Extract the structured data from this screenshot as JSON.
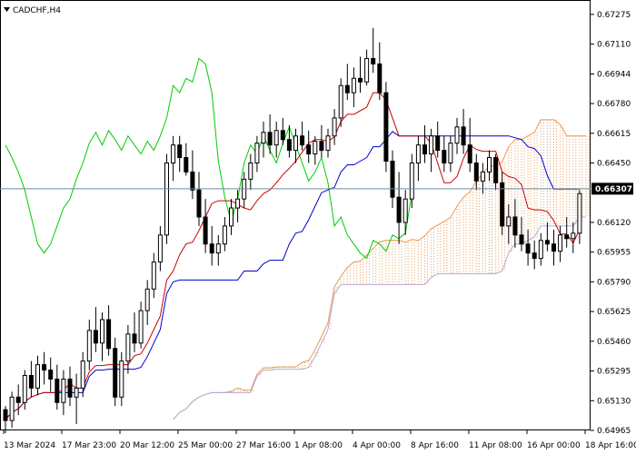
{
  "window": {
    "symbol_label": "CADCHF,H4"
  },
  "price_axis": {
    "labels": [
      "0.67275",
      "0.67110",
      "0.66944",
      "0.66780",
      "0.66615",
      "0.66450",
      "0.66120",
      "0.65955",
      "0.65790",
      "0.65625",
      "0.65460",
      "0.65295",
      "0.65130",
      "0.64965"
    ],
    "current_price": "0.66307"
  },
  "time_axis": {
    "labels": [
      "13 Mar 2024",
      "17 Mar 23:00",
      "20 Mar 12:00",
      "25 Mar 00:00",
      "27 Mar 16:00",
      "1 Apr 08:00",
      "4 Apr 00:00",
      "8 Apr 16:00",
      "11 Apr 08:00",
      "16 Apr 00:00",
      "18 Apr 16:00"
    ]
  },
  "colors": {
    "background": "#ffffff",
    "grid": "#c8c8c8",
    "candle": "#000000",
    "tenkan": "#cc0000",
    "kijun": "#0000cc",
    "chikou": "#00cc00",
    "cloud_bull": "#e69a50",
    "cloud_bear": "#b8a8d8",
    "price_line": "#6f8a9a",
    "price_tag_bg": "#000000"
  },
  "chart_data": {
    "type": "candlestick",
    "title": "CADCHF,H4",
    "xlabel": "",
    "ylabel": "",
    "ylim": [
      0.64965,
      0.67355
    ],
    "current_price": 0.66307,
    "indicators": [
      "Ichimoku Kinko Hyo"
    ],
    "candles": [
      [
        0.6508,
        0.651,
        0.6495,
        0.6502
      ],
      [
        0.6502,
        0.6518,
        0.6498,
        0.6515
      ],
      [
        0.6515,
        0.6522,
        0.6505,
        0.6512
      ],
      [
        0.6512,
        0.653,
        0.6508,
        0.6527
      ],
      [
        0.6527,
        0.6535,
        0.6515,
        0.652
      ],
      [
        0.652,
        0.6538,
        0.6516,
        0.6533
      ],
      [
        0.6533,
        0.654,
        0.6522,
        0.653
      ],
      [
        0.653,
        0.6537,
        0.6518,
        0.6525
      ],
      [
        0.6525,
        0.6533,
        0.6508,
        0.6512
      ],
      [
        0.6512,
        0.653,
        0.6505,
        0.6525
      ],
      [
        0.6525,
        0.6532,
        0.651,
        0.6515
      ],
      [
        0.6515,
        0.6528,
        0.65,
        0.652
      ],
      [
        0.652,
        0.654,
        0.6515,
        0.6535
      ],
      [
        0.6535,
        0.6558,
        0.653,
        0.6552
      ],
      [
        0.6552,
        0.6565,
        0.654,
        0.6545
      ],
      [
        0.6545,
        0.6562,
        0.6535,
        0.6558
      ],
      [
        0.6558,
        0.6566,
        0.6538,
        0.6542
      ],
      [
        0.6542,
        0.6548,
        0.651,
        0.6515
      ],
      [
        0.6515,
        0.654,
        0.651,
        0.6535
      ],
      [
        0.6535,
        0.6555,
        0.6528,
        0.655
      ],
      [
        0.655,
        0.6562,
        0.654,
        0.6545
      ],
      [
        0.6545,
        0.6568,
        0.6542,
        0.6563
      ],
      [
        0.6563,
        0.658,
        0.6555,
        0.6575
      ],
      [
        0.6575,
        0.6595,
        0.657,
        0.659
      ],
      [
        0.659,
        0.661,
        0.6585,
        0.6605
      ],
      [
        0.6605,
        0.665,
        0.66,
        0.6645
      ],
      [
        0.6645,
        0.666,
        0.6635,
        0.6655
      ],
      [
        0.6655,
        0.666,
        0.664,
        0.6648
      ],
      [
        0.6648,
        0.6656,
        0.6638,
        0.664
      ],
      [
        0.664,
        0.6652,
        0.6625,
        0.663
      ],
      [
        0.663,
        0.664,
        0.661,
        0.6615
      ],
      [
        0.6615,
        0.6625,
        0.6595,
        0.66
      ],
      [
        0.66,
        0.661,
        0.6588,
        0.6595
      ],
      [
        0.6595,
        0.6605,
        0.6588,
        0.66
      ],
      [
        0.66,
        0.6615,
        0.6596,
        0.661
      ],
      [
        0.661,
        0.6625,
        0.6605,
        0.662
      ],
      [
        0.662,
        0.663,
        0.6612,
        0.6625
      ],
      [
        0.6625,
        0.664,
        0.662,
        0.6636
      ],
      [
        0.6636,
        0.665,
        0.663,
        0.6645
      ],
      [
        0.6645,
        0.666,
        0.664,
        0.6656
      ],
      [
        0.6656,
        0.6668,
        0.6648,
        0.6662
      ],
      [
        0.6662,
        0.6672,
        0.665,
        0.6655
      ],
      [
        0.6655,
        0.6668,
        0.6648,
        0.6663
      ],
      [
        0.6663,
        0.667,
        0.6655,
        0.6658
      ],
      [
        0.6658,
        0.6666,
        0.6648,
        0.6652
      ],
      [
        0.6652,
        0.6664,
        0.6645,
        0.666
      ],
      [
        0.666,
        0.6668,
        0.6652,
        0.6655
      ],
      [
        0.6655,
        0.6663,
        0.6645,
        0.665
      ],
      [
        0.665,
        0.666,
        0.6644,
        0.6657
      ],
      [
        0.6657,
        0.6666,
        0.6648,
        0.6652
      ],
      [
        0.6652,
        0.6664,
        0.6648,
        0.666
      ],
      [
        0.666,
        0.6675,
        0.6655,
        0.667
      ],
      [
        0.667,
        0.6692,
        0.6665,
        0.6688
      ],
      [
        0.6688,
        0.67,
        0.668,
        0.6684
      ],
      [
        0.6684,
        0.6698,
        0.6676,
        0.6692
      ],
      [
        0.6692,
        0.6704,
        0.6684,
        0.669
      ],
      [
        0.669,
        0.6708,
        0.6688,
        0.6703
      ],
      [
        0.6703,
        0.672,
        0.6695,
        0.67
      ],
      [
        0.67,
        0.6712,
        0.668,
        0.6684
      ],
      [
        0.6684,
        0.669,
        0.664,
        0.6646
      ],
      [
        0.6646,
        0.6652,
        0.662,
        0.6626
      ],
      [
        0.6626,
        0.664,
        0.66,
        0.6612
      ],
      [
        0.6612,
        0.663,
        0.6605,
        0.6625
      ],
      [
        0.6625,
        0.665,
        0.662,
        0.6645
      ],
      [
        0.6645,
        0.666,
        0.6635,
        0.6655
      ],
      [
        0.6655,
        0.6666,
        0.6645,
        0.665
      ],
      [
        0.665,
        0.6664,
        0.664,
        0.666
      ],
      [
        0.666,
        0.6668,
        0.6648,
        0.6652
      ],
      [
        0.6652,
        0.666,
        0.664,
        0.6645
      ],
      [
        0.6645,
        0.666,
        0.664,
        0.6656
      ],
      [
        0.6656,
        0.667,
        0.665,
        0.6665
      ],
      [
        0.6665,
        0.6675,
        0.665,
        0.6655
      ],
      [
        0.6655,
        0.667,
        0.664,
        0.6645
      ],
      [
        0.6645,
        0.665,
        0.663,
        0.6635
      ],
      [
        0.6635,
        0.6645,
        0.6628,
        0.664
      ],
      [
        0.664,
        0.6652,
        0.6635,
        0.6648
      ],
      [
        0.6648,
        0.665,
        0.663,
        0.6634
      ],
      [
        0.6634,
        0.664,
        0.6605,
        0.661
      ],
      [
        0.661,
        0.6622,
        0.66,
        0.6615
      ],
      [
        0.6615,
        0.6625,
        0.6598,
        0.6605
      ],
      [
        0.6605,
        0.6615,
        0.6596,
        0.66
      ],
      [
        0.66,
        0.6608,
        0.6588,
        0.6595
      ],
      [
        0.6595,
        0.6602,
        0.6586,
        0.6592
      ],
      [
        0.6592,
        0.6606,
        0.6588,
        0.6602
      ],
      [
        0.6602,
        0.6612,
        0.6596,
        0.66
      ],
      [
        0.66,
        0.6608,
        0.6588,
        0.6596
      ],
      [
        0.6596,
        0.661,
        0.659,
        0.6605
      ],
      [
        0.6605,
        0.6615,
        0.6598,
        0.6603
      ],
      [
        0.6603,
        0.6612,
        0.6595,
        0.6606
      ],
      [
        0.6606,
        0.663,
        0.66,
        0.6628
      ]
    ]
  }
}
